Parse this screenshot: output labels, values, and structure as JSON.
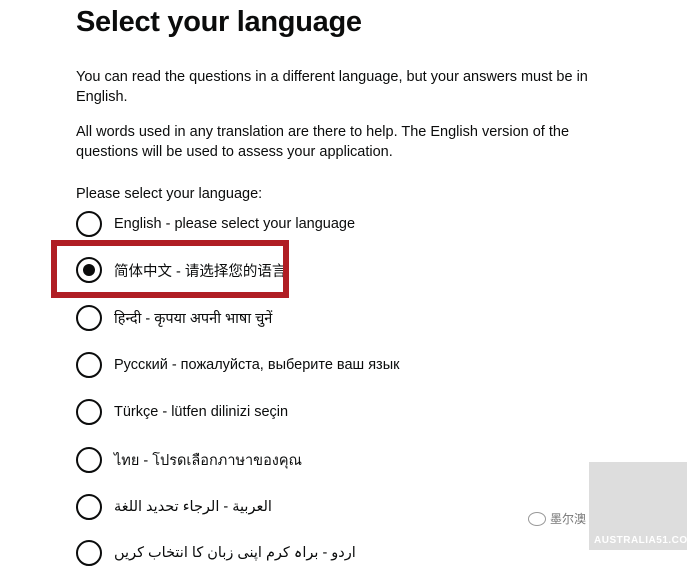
{
  "title": "Select your language",
  "intro": [
    "You can read the questions in a different language, but your answers must be in English.",
    "All words used in any translation are there to help. The English version of the questions will be used to assess your application."
  ],
  "legend": "Please select your language:",
  "options": [
    {
      "label": "English - please select your language",
      "checked": false
    },
    {
      "label": "简体中文 - 请选择您的语言",
      "checked": true
    },
    {
      "label": "हिन्दी - कृपया अपनी भाषा चुनें",
      "checked": false
    },
    {
      "label": "Русский - пожалуйста, выберите ваш язык",
      "checked": false
    },
    {
      "label": "Türkçe - lütfen dilinizi seçin",
      "checked": false
    },
    {
      "label": "ไทย - โปรดเลือกภาษาของคุณ",
      "checked": false
    },
    {
      "label": "العربية - الرجاء تحديد اللغة",
      "checked": false
    },
    {
      "label": "اردو - براہ کرم اپنی زبان کا انتخاب کریں",
      "checked": false
    }
  ],
  "watermark": {
    "wechat_text": "墨尔澳",
    "site": "AUSTRALIA51.COM"
  },
  "colors": {
    "text": "#0b0c0c",
    "highlight": "#b01e24"
  }
}
